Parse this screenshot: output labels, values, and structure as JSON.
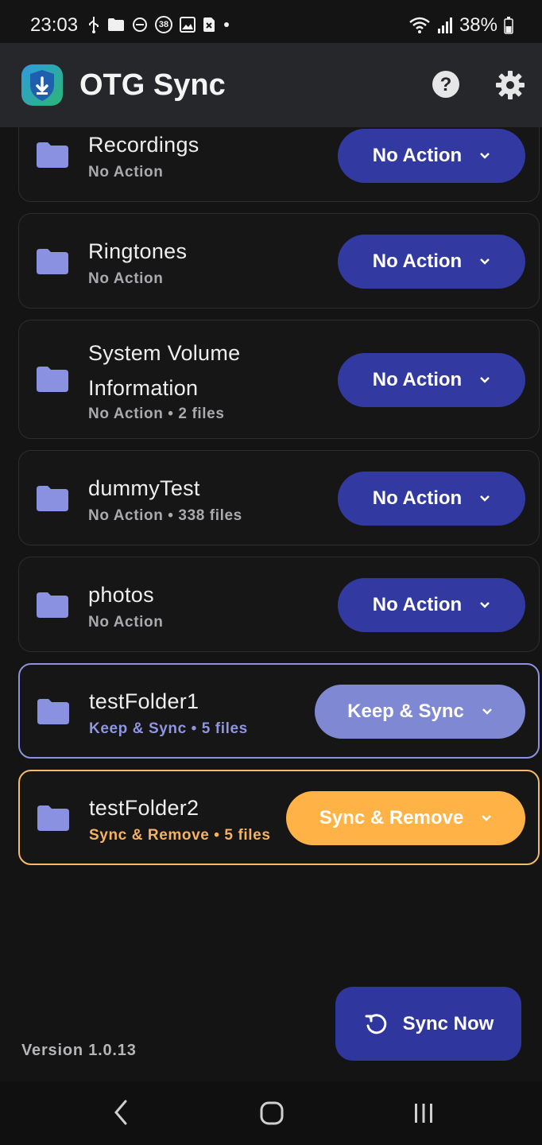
{
  "status_bar": {
    "time": "23:03",
    "battery": "38%",
    "notification_badge": "38",
    "left_icons": [
      "usb-icon",
      "folder-icon",
      "dnd-icon",
      "badge-icon",
      "image-icon",
      "sim-icon",
      "dot-icon"
    ],
    "right_icons": [
      "wifi-icon",
      "signal-icon",
      "battery-icon"
    ]
  },
  "app_bar": {
    "title": "OTG Sync",
    "logo_icon": "shield-download-icon",
    "help_icon": "help-icon",
    "settings_icon": "gear-icon"
  },
  "folders": [
    {
      "name": "Recordings",
      "subtitle": "No Action",
      "action": "No Action",
      "state": "none"
    },
    {
      "name": "Ringtones",
      "subtitle": "No Action",
      "action": "No Action",
      "state": "none"
    },
    {
      "name": "System Volume\nInformation",
      "subtitle": "No Action • 2 files",
      "action": "No Action",
      "state": "none"
    },
    {
      "name": "dummyTest",
      "subtitle": "No Action • 338 files",
      "action": "No Action",
      "state": "none"
    },
    {
      "name": "photos",
      "subtitle": "No Action",
      "action": "No Action",
      "state": "none"
    },
    {
      "name": "testFolder1",
      "subtitle": "Keep & Sync • 5 files",
      "action": "Keep & Sync",
      "state": "keep"
    },
    {
      "name": "testFolder2",
      "subtitle": "Sync & Remove • 5 files",
      "action": "Sync & Remove",
      "state": "remove"
    }
  ],
  "footer": {
    "version": "Version 1.0.13",
    "sync_button": "Sync Now"
  },
  "colors": {
    "primary": "#3239a1",
    "keep": "#7f88d2",
    "remove": "#ffb347",
    "background": "#141414"
  }
}
